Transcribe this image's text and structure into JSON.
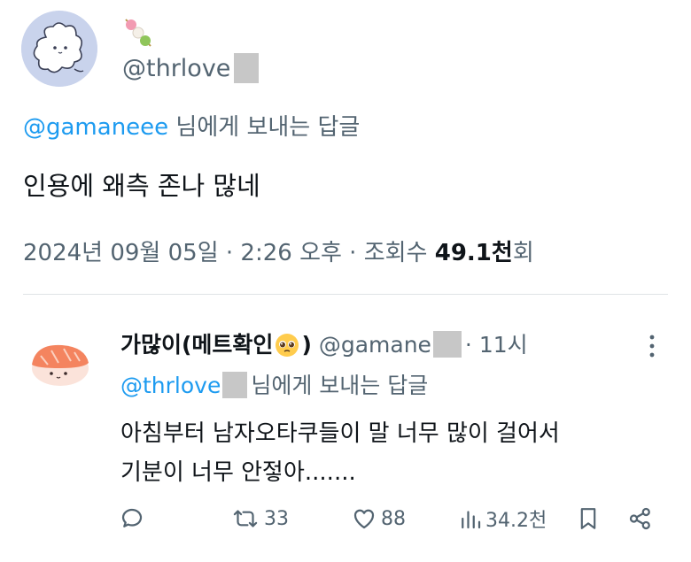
{
  "tweet": {
    "handle": "@thrlove",
    "reply_to_handle": "@gamaneee",
    "reply_to_suffix": " 님에게 보내는 답글",
    "text": "인용에 왜측 존나 많네",
    "date": "2024년 09월 05일 · 2:26 오후 · 조회수 ",
    "views_number": "49.1천",
    "views_suffix": "회"
  },
  "reply": {
    "name": "가많이(메트확인",
    "name_close": ")",
    "handle": "@gamane",
    "dot": "·",
    "time": "11시",
    "reply_to_handle": "@thrlove",
    "reply_to_suffix": "님에게 보내는 답글",
    "text_line1": "아침부터 남자오타쿠들이 말 너무 많이 걸어서",
    "text_line2": "기분이 너무 안젛아.......",
    "actions": {
      "retweets": "33",
      "likes": "88",
      "views": "34.2천"
    }
  },
  "colors": {
    "mention": "#1d9bf0",
    "secondary_text": "#536471",
    "primary_text": "#0f1419"
  },
  "icons": [
    "dango-emoji-icon",
    "pleading-face-emoji-icon",
    "more-icon",
    "reply-icon",
    "retweet-icon",
    "like-icon",
    "views-icon",
    "bookmark-icon",
    "share-icon"
  ]
}
